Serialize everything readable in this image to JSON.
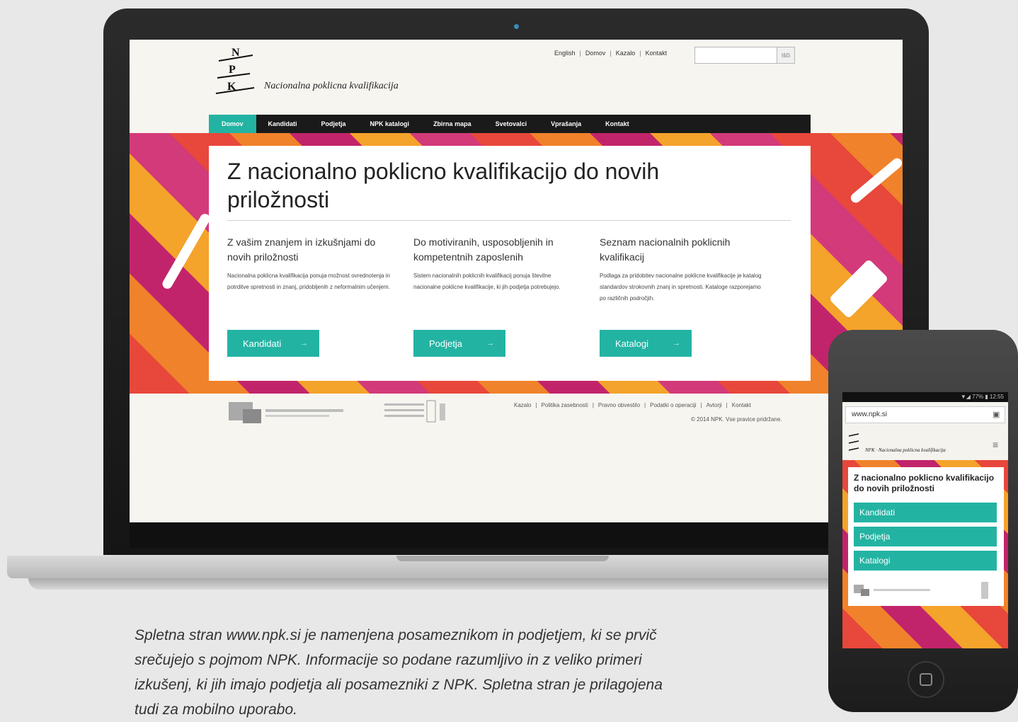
{
  "laptop": {
    "site": {
      "logo_letters": [
        "N",
        "P",
        "K"
      ],
      "logo_text": "Nacionalna poklicna kvalifikacija",
      "top_nav": [
        "English",
        "Domov",
        "Kazalo",
        "Kontakt"
      ],
      "search": {
        "placeholder": "",
        "button": "Išči"
      },
      "main_nav": [
        "Domov",
        "Kandidati",
        "Podjetja",
        "NPK katalogi",
        "Zbirna mapa",
        "Svetovalci",
        "Vprašanja",
        "Kontakt"
      ],
      "hero_title": "Z nacionalno poklicno kvalifikacijo do novih priložnosti",
      "columns": [
        {
          "title": "Z vašim znanjem in izkušnjami do novih priložnosti",
          "text": "Nacionalna poklicna kvalifikacija ponuja možnost ovrednotenja in potrditve spretnosti in znanj, pridobljenih z neformalnim učenjem.",
          "button": "Kandidati"
        },
        {
          "title": "Do motiviranih, usposobljenih in kompetentnih zaposlenih",
          "text": "Sistem nacionalnih poklicnih kvalifikacij ponuja številne nacionalne poklicne kvalifikacije, ki jih podjetja potrebujejo.",
          "button": "Podjetja"
        },
        {
          "title": "Seznam nacionalnih poklicnih kvalifikacij",
          "text": "Podlaga za pridobitev nacionalne poklicne kvalifikacije je katalog standardov strokovnih znanj in spretnosti. Kataloge razporejamo po različnih področjih.",
          "button": "Katalogi"
        }
      ],
      "button_arrow": "→",
      "footer_links": [
        "Kazalo",
        "Politika zasebnosti",
        "Pravno obvestilo",
        "Podatki o operaciji",
        "Avtorji",
        "Kontakt"
      ],
      "copyright": "© 2014 NPK. Vse pravice pridržane."
    }
  },
  "phone": {
    "status": "▼◢ 77% ▮ 12:55",
    "url": "www.npk.si",
    "logo_text": "NPK · Nacionalna poklicna kvalifikacija",
    "title": "Z nacionalno poklicno kvalifikacijo do novih priložnosti",
    "buttons": [
      "Kandidati",
      "Podjetja",
      "Katalogi"
    ]
  },
  "caption": "Spletna stran www.npk.si je namenjena posameznikom in podjetjem, ki se prvič srečujejo s pojmom NPK. Informacije so podane razumljivo in z veliko primeri izkušenj, ki jih imajo podjetja ali posamezniki z NPK. Spletna stran je prilagojena tudi za mobilno uporabo.",
  "colors": {
    "teal": "#23b3a3",
    "nav_bg": "#1a1a1a",
    "orange": "#f0822b",
    "red": "#e8473b",
    "magenta": "#c2246b"
  }
}
